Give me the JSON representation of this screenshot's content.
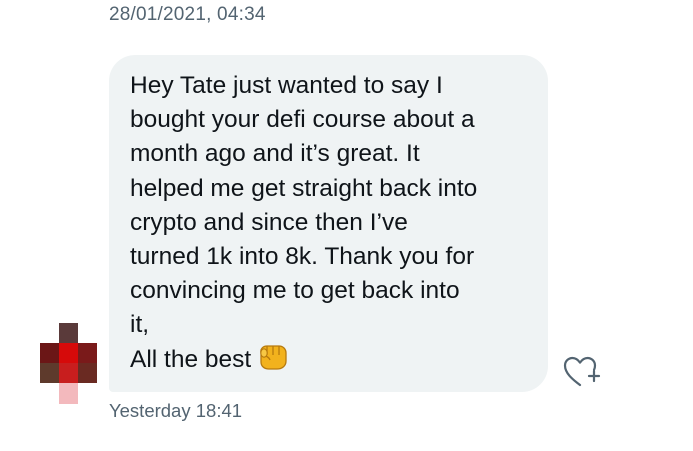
{
  "conversation": {
    "date_header": "28/01/2021, 04:34",
    "message": {
      "lines": "Hey Tate just wanted to say I\nbought your defi course about a\nmonth ago and it’s great. It\nhelped me get straight back into\ncrypto and since then I’ve\nturned 1k into 8k. Thank you for\nconvincing me to get back into\nit,\nAll the best",
      "emoji_icon": "oncoming-fist-icon",
      "timestamp": "Yesterday 18:41"
    },
    "avatar": {
      "type": "pixelated-avatar"
    },
    "react_icon": "heart-plus-icon"
  },
  "colors": {
    "bubble_bg": "#eff3f4",
    "meta_text": "#536471",
    "message_text": "#0f1419"
  }
}
